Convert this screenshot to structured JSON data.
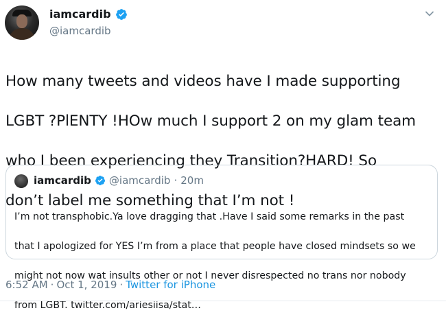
{
  "tweet": {
    "display_name": "iamcardib",
    "handle": "@iamcardib",
    "text_lines": [
      "How many tweets and videos have I made supporting",
      "LGBT ?PlENTY !HOw much I support 2 on my glam team",
      "who I been experiencing they Transition?HARD! So",
      "don’t label me something that I’m not !"
    ],
    "icons": {
      "avatar": "avatar-image",
      "verified": "verified-badge-icon",
      "menu": "chevron-down-icon"
    }
  },
  "quote": {
    "display_name": "iamcardib",
    "handle": "@iamcardib",
    "separator": "·",
    "age": "20m",
    "text_lines": [
      "I’m not transphobic.Ya love dragging that .Have I said some remarks in the past",
      "that I apologized for YES I’m from a place that people have closed mindsets so we",
      "might not now wat insults other or not I never disrespected no trans nor nobody",
      "from LGBT. twitter.com/ariesiisa/stat…"
    ]
  },
  "footer": {
    "time": "6:52 AM",
    "sep1": "·",
    "date": "Oct 1, 2019",
    "sep2": "·",
    "source": "Twitter for iPhone"
  },
  "colors": {
    "accent": "#1da1f2",
    "link": "#1b95e0",
    "muted": "#657786",
    "border": "#ccd6dd"
  }
}
